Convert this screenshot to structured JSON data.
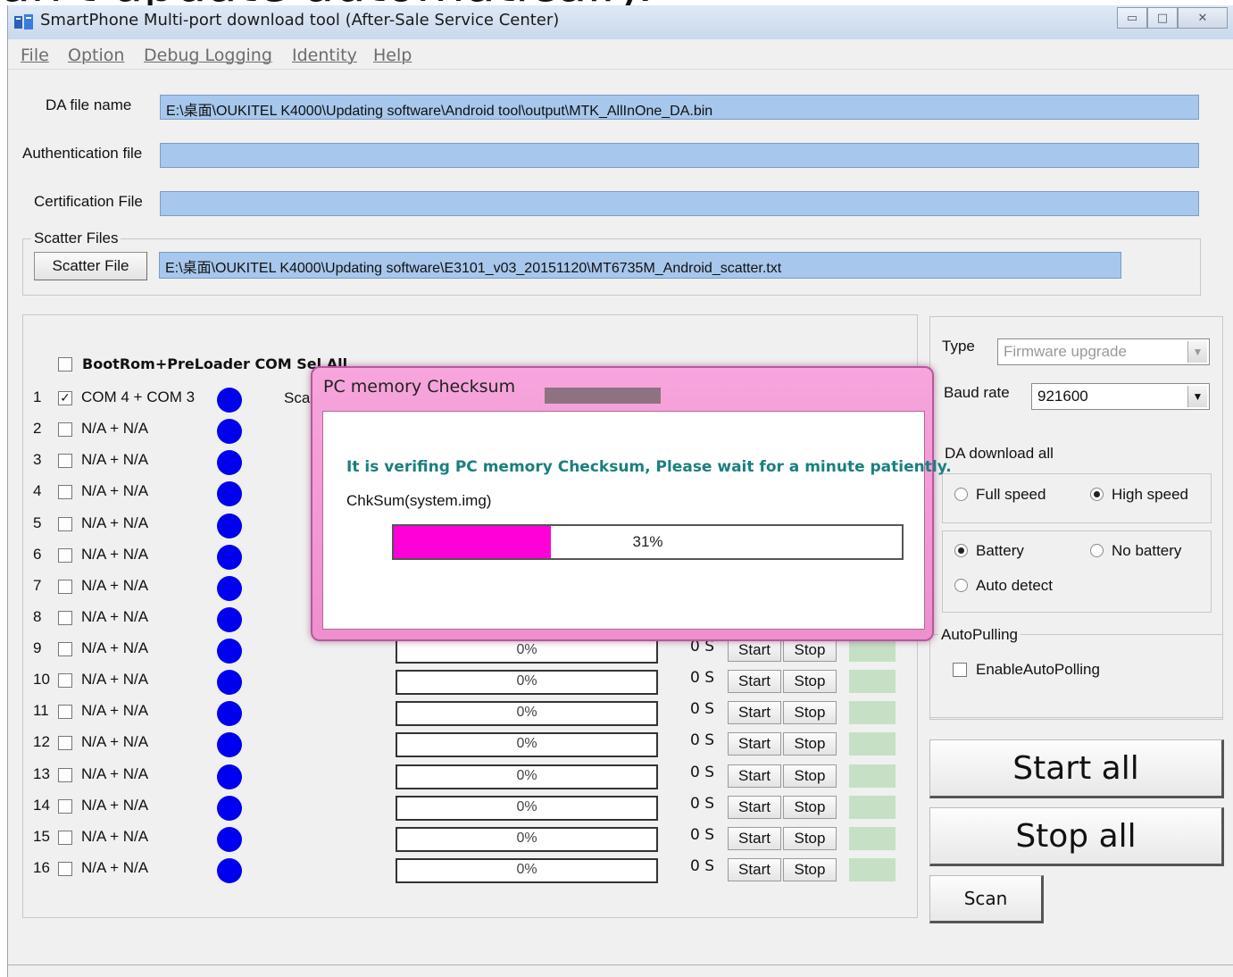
{
  "caption": "an't update automatically.",
  "window": {
    "title": "SmartPhone Multi-port download tool (After-Sale Service Center)",
    "minimize_label": "▭",
    "maximize_label": "□",
    "close_label": "✕"
  },
  "menu": [
    "File",
    "Option",
    "Debug Logging",
    "Identity",
    "Help"
  ],
  "files": {
    "da_label": "DA file name",
    "da_value": "E:\\桌面\\OUKITEL K4000\\Updating software\\Android tool\\output\\MTK_AllInOne_DA.bin",
    "auth_label": "Authentication file",
    "auth_value": "",
    "cert_label": "Certification File",
    "cert_value": "",
    "scatter_group": "Scatter Files",
    "scatter_button": "Scatter File",
    "scatter_value": "E:\\桌面\\OUKITEL K4000\\Updating software\\E3101_v03_20151120\\MT6735M_Android_scatter.txt"
  },
  "ports": {
    "header_checkbox_label": "BootRom+PreLoader COM Sel All",
    "header_checked": false,
    "scan_col_partial": "Sca",
    "start_label": "Start",
    "stop_label": "Stop",
    "rows": [
      {
        "num": "1",
        "port": "COM 4 + COM 3",
        "checked": true,
        "progress": "",
        "time": ""
      },
      {
        "num": "2",
        "port": "N/A + N/A",
        "checked": false,
        "progress": "",
        "time": ""
      },
      {
        "num": "3",
        "port": "N/A + N/A",
        "checked": false,
        "progress": "",
        "time": ""
      },
      {
        "num": "4",
        "port": "N/A + N/A",
        "checked": false,
        "progress": "",
        "time": ""
      },
      {
        "num": "5",
        "port": "N/A + N/A",
        "checked": false,
        "progress": "",
        "time": ""
      },
      {
        "num": "6",
        "port": "N/A + N/A",
        "checked": false,
        "progress": "",
        "time": ""
      },
      {
        "num": "7",
        "port": "N/A + N/A",
        "checked": false,
        "progress": "",
        "time": ""
      },
      {
        "num": "8",
        "port": "N/A + N/A",
        "checked": false,
        "progress": "",
        "time": ""
      },
      {
        "num": "9",
        "port": "N/A + N/A",
        "checked": false,
        "progress": "0%",
        "time": "0 S"
      },
      {
        "num": "10",
        "port": "N/A + N/A",
        "checked": false,
        "progress": "0%",
        "time": "0 S"
      },
      {
        "num": "11",
        "port": "N/A + N/A",
        "checked": false,
        "progress": "0%",
        "time": "0 S"
      },
      {
        "num": "12",
        "port": "N/A + N/A",
        "checked": false,
        "progress": "0%",
        "time": "0 S"
      },
      {
        "num": "13",
        "port": "N/A + N/A",
        "checked": false,
        "progress": "0%",
        "time": "0 S"
      },
      {
        "num": "14",
        "port": "N/A + N/A",
        "checked": false,
        "progress": "0%",
        "time": "0 S"
      },
      {
        "num": "15",
        "port": "N/A + N/A",
        "checked": false,
        "progress": "0%",
        "time": "0 S"
      },
      {
        "num": "16",
        "port": "N/A + N/A",
        "checked": false,
        "progress": "0%",
        "time": "0 S"
      }
    ]
  },
  "settings": {
    "type_label": "Type",
    "type_value": "Firmware upgrade",
    "baud_label": "Baud rate",
    "baud_value": "921600",
    "da_group": "DA download all",
    "full_speed": "Full speed",
    "high_speed": "High speed",
    "speed_selected": "high",
    "battery": "Battery",
    "no_battery": "No battery",
    "auto_detect": "Auto detect",
    "battery_selected": "battery",
    "autopolling_group": "AutoPulling",
    "enable_autopolling": "EnableAutoPolling",
    "start_all": "Start all",
    "stop_all": "Stop all",
    "scan": "Scan"
  },
  "dialog": {
    "title": "PC memory Checksum",
    "message": "It is verifing PC memory Checksum, Please wait for a minute  patiently.",
    "file": "ChkSum(system.img)",
    "progress_text": "31%",
    "progress_fraction": 0.31
  },
  "colors": {
    "field_bg": "#a7c7ec",
    "dialog_frame": "#ee8fce",
    "progress_fill": "#ff00d8",
    "message_text": "#1a7f7f",
    "status_led": "#0000ee",
    "status_cell": "#c6e0c6"
  }
}
